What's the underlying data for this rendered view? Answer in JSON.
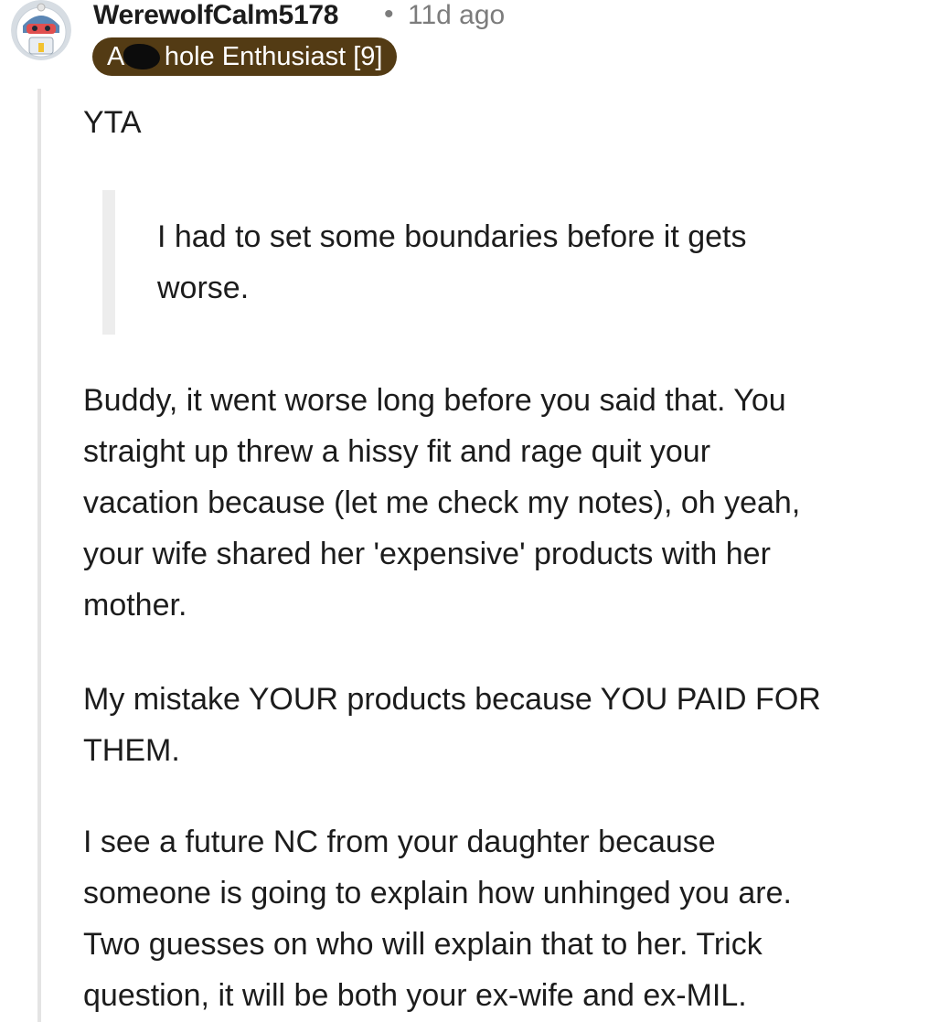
{
  "comment": {
    "username": "WerewolfCalm5178",
    "separator": "•",
    "timestamp": "11d ago",
    "flair": "A  hole Enthusiast [9]",
    "verdict": "YTA",
    "quote_lines": [
      "I had to set some boundaries before it gets",
      "worse."
    ],
    "paragraph1_lines": [
      "Buddy, it went worse long before you said that. You",
      "straight up threw a hissy fit and rage quit your",
      "vacation because (let me check my notes), oh yeah,",
      "your wife shared her 'expensive' products with her",
      "mother."
    ],
    "paragraph2_lines": [
      "My mistake YOUR products because YOU PAID FOR",
      "THEM."
    ],
    "paragraph3_lines": [
      "I see a future NC from your daughter because",
      "someone is going to explain how unhinged you are.",
      "Two guesses on who will explain that to her. Trick",
      "question, it will be both your ex-wife and ex-MIL."
    ]
  },
  "colors": {
    "flair_background": "#533b14",
    "flair_text": "#ffffff",
    "meta_text": "#7c7c7c",
    "thread_line": "#e4e4e4"
  },
  "icons": {
    "avatar": "snoo-avatar-icon"
  }
}
